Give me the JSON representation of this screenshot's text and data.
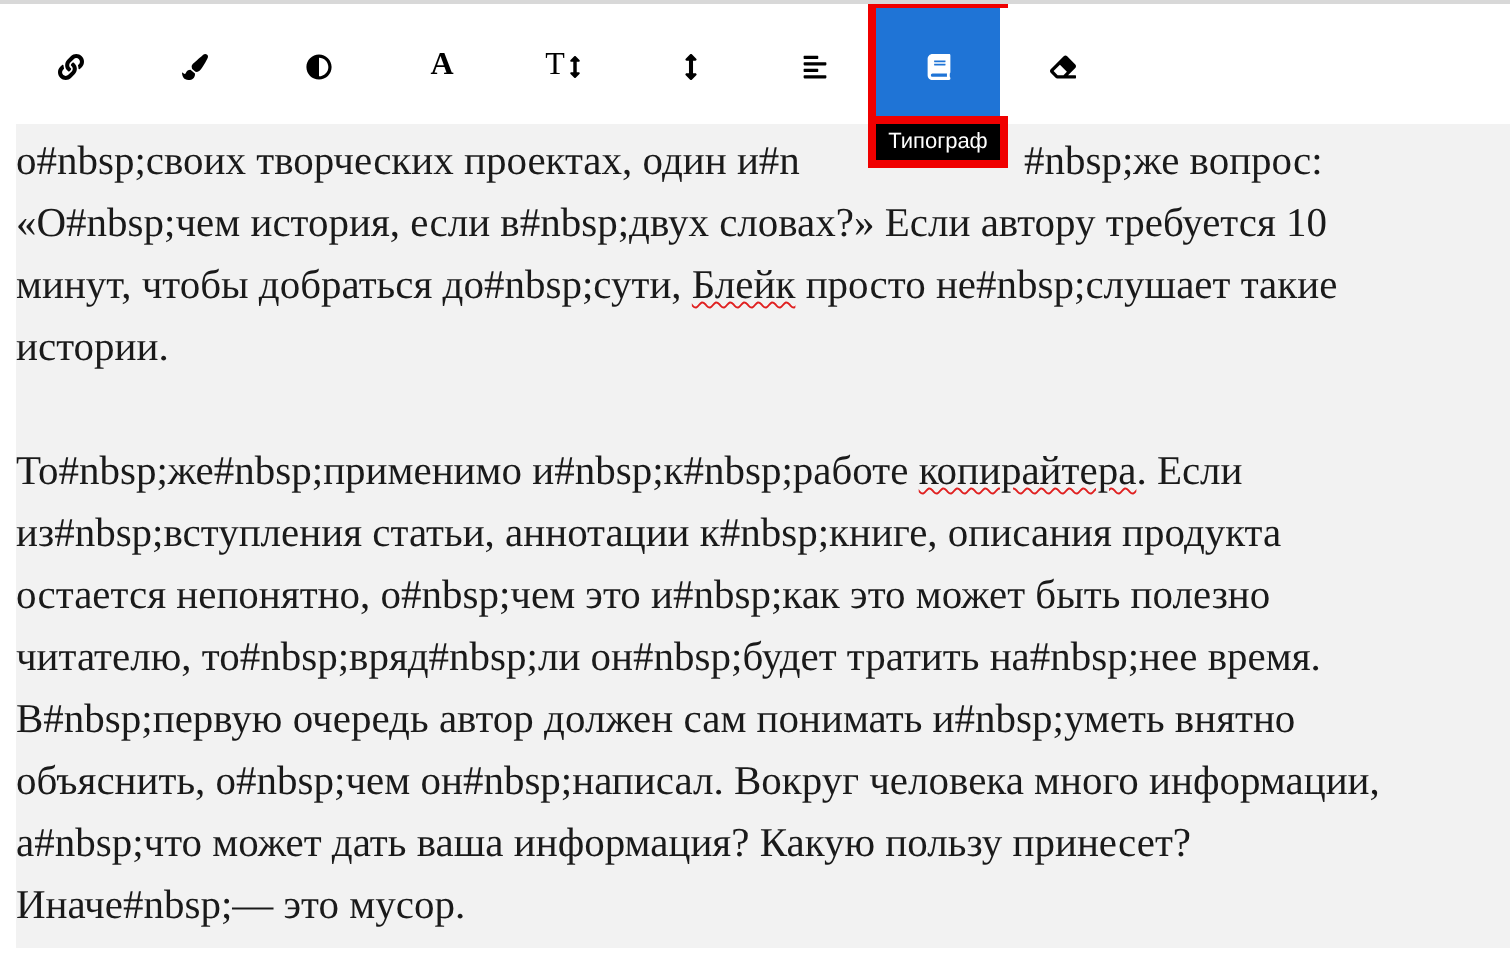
{
  "toolbar": {
    "buttons": [
      {
        "kind": "icon",
        "selected": false
      },
      {
        "kind": "icon",
        "selected": false
      },
      {
        "kind": "icon",
        "selected": false
      },
      {
        "kind": "letter",
        "label": "A",
        "selected": false
      },
      {
        "kind": "letter-arrow",
        "label": "T",
        "selected": false
      },
      {
        "kind": "icon",
        "selected": false
      },
      {
        "kind": "icon",
        "selected": false
      },
      {
        "kind": "icon",
        "selected": true,
        "tooltip": "Типограф"
      },
      {
        "kind": "icon",
        "selected": false
      }
    ]
  },
  "editor": {
    "paragraphs": [
      {
        "lines": [
          [
            {
              "text": "о#nbsp;своих творческих проектах, один и#n",
              "misspelled": false
            },
            {
              "kind": "gap"
            },
            {
              "text": "#nbsp;же вопрос:",
              "misspelled": false
            }
          ],
          [
            {
              "text": "«О#nbsp;чем история, если в#nbsp;двух словах?» Если автору требуется 10",
              "misspelled": false
            }
          ],
          [
            {
              "text": "минут, чтобы добраться до#nbsp;сути, ",
              "misspelled": false
            },
            {
              "text": "Блейк",
              "misspelled": true
            },
            {
              "text": " просто не#nbsp;слушает такие",
              "misspelled": false
            }
          ],
          [
            {
              "text": "истории.",
              "misspelled": false
            }
          ]
        ]
      },
      {
        "lines": [
          [
            {
              "text": "То#nbsp;же#nbsp;применимо и#nbsp;к#nbsp;работе ",
              "misspelled": false
            },
            {
              "text": "копирайтера",
              "misspelled": true
            },
            {
              "text": ". Если",
              "misspelled": false
            }
          ],
          [
            {
              "text": "из#nbsp;вступления статьи, аннотации к#nbsp;книге, описания продукта",
              "misspelled": false
            }
          ],
          [
            {
              "text": "остается непонятно, о#nbsp;чем это и#nbsp;как это может быть полезно",
              "misspelled": false
            }
          ],
          [
            {
              "text": "читателю, то#nbsp;вряд#nbsp;ли он#nbsp;будет тратить на#nbsp;нее время.",
              "misspelled": false
            }
          ],
          [
            {
              "text": "В#nbsp;первую очередь автор должен сам понимать и#nbsp;уметь внятно",
              "misspelled": false
            }
          ],
          [
            {
              "text": "объяснить, о#nbsp;чем он#nbsp;написал. Вокруг человека много информации,",
              "misspelled": false
            }
          ],
          [
            {
              "text": "а#nbsp;что может дать ваша информация? Какую пользу принесет?",
              "misspelled": false
            }
          ],
          [
            {
              "text": "Иначе#nbsp;— это мусор.",
              "misspelled": false
            }
          ]
        ]
      }
    ]
  }
}
